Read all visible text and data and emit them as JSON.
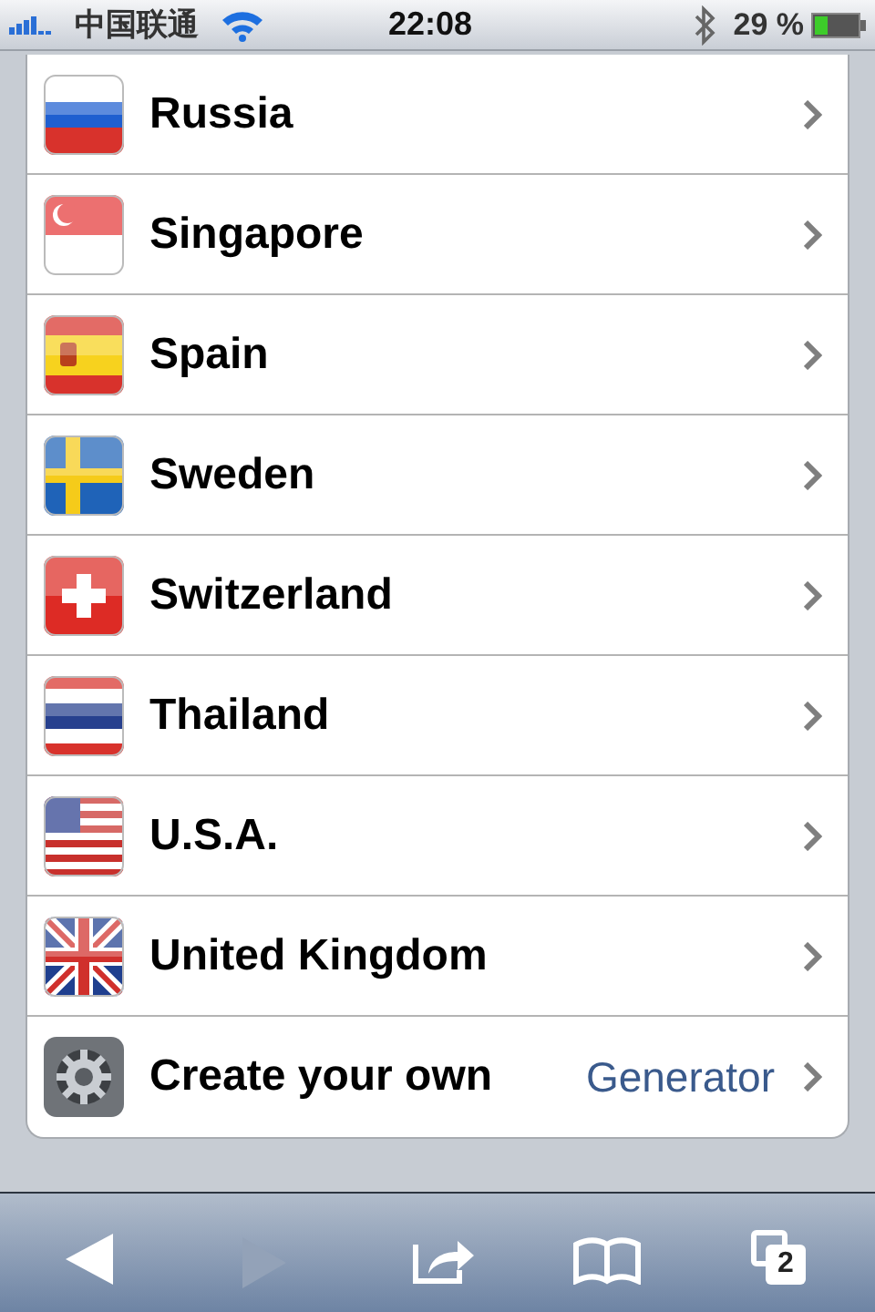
{
  "status_bar": {
    "carrier": "中国联通",
    "time": "22:08",
    "battery": "29 %"
  },
  "list": [
    {
      "label": "Russia",
      "kind": "russia"
    },
    {
      "label": "Singapore",
      "kind": "singapore"
    },
    {
      "label": "Spain",
      "kind": "spain"
    },
    {
      "label": "Sweden",
      "kind": "sweden"
    },
    {
      "label": "Switzerland",
      "kind": "switzerland"
    },
    {
      "label": "Thailand",
      "kind": "thailand"
    },
    {
      "label": "U.S.A.",
      "kind": "usa"
    },
    {
      "label": "United Kingdom",
      "kind": "uk"
    },
    {
      "label": "Create your own",
      "kind": "generator",
      "detail": "Generator"
    }
  ],
  "toolbar": {
    "back": {
      "disabled": false
    },
    "forward": {
      "disabled": true
    },
    "tab_count": "2"
  }
}
